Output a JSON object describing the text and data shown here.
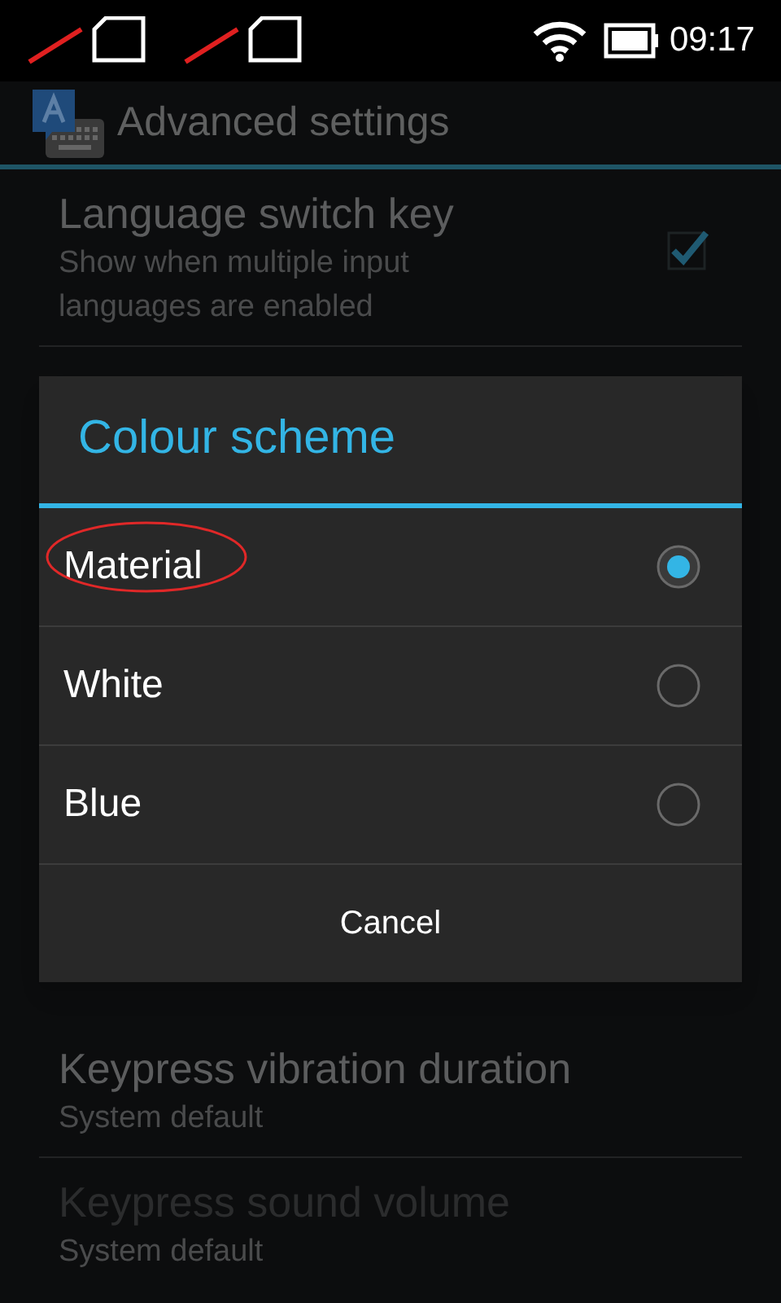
{
  "status_bar": {
    "time": "09:17"
  },
  "action_bar": {
    "title": "Advanced settings"
  },
  "preferences_top": [
    {
      "kind": "checkbox",
      "title": "Language switch key",
      "summary": "Show when multiple input languages are enabled",
      "checked": true
    }
  ],
  "preferences_bottom": [
    {
      "title": "Keypress vibration duration",
      "summary": "System default",
      "disabled": false
    },
    {
      "title": "Keypress sound volume",
      "summary": "System default",
      "disabled": true
    }
  ],
  "dialog": {
    "title": "Colour scheme",
    "options": [
      {
        "label": "Material",
        "selected": true,
        "highlighted": true
      },
      {
        "label": "White",
        "selected": false,
        "highlighted": false
      },
      {
        "label": "Blue",
        "selected": false,
        "highlighted": false
      }
    ],
    "button": "Cancel"
  }
}
